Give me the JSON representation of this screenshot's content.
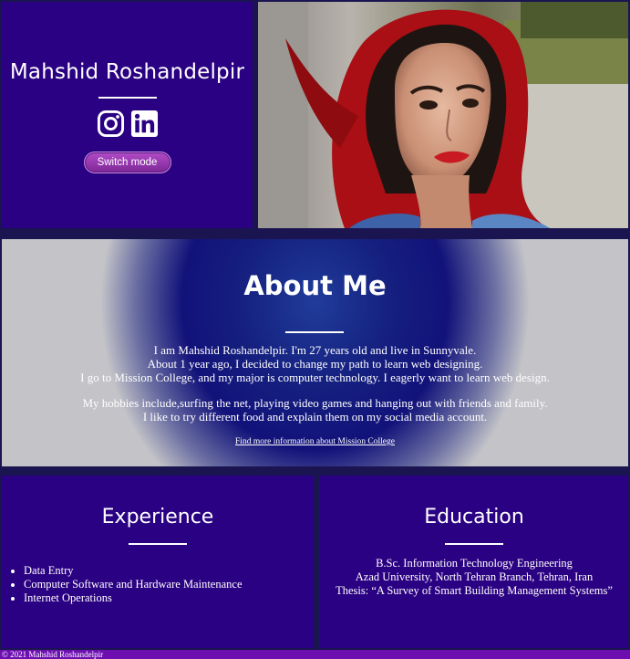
{
  "hero": {
    "name": "Mahshid Roshandelpir",
    "social": [
      {
        "icon": "instagram-icon"
      },
      {
        "icon": "linkedin-icon"
      }
    ],
    "switch_label": "Switch mode",
    "colors": {
      "panel": "#2a0182",
      "button": "#9a3bb6"
    }
  },
  "about": {
    "title": "About Me",
    "paragraph1": [
      "I am Mahshid Roshandelpir. I'm 27 years old and live in Sunnyvale.",
      "About 1 year ago, I decided to change my path to learn web designing.",
      "I go to Mission College, and my major is computer technology. I eagerly want to learn web design."
    ],
    "paragraph2": [
      "My hobbies include,surfing the net, playing video games and hanging out with friends and family.",
      "I like to try different food and explain them on my social media account."
    ],
    "link_text": "Find more information about Mission College"
  },
  "experience": {
    "title": "Experience",
    "items": [
      "Data Entry",
      "Computer Software and Hardware Maintenance",
      "Internet Operations"
    ]
  },
  "education": {
    "title": "Education",
    "lines": [
      "B.Sc. Information Technology Engineering",
      "Azad University, North Tehran Branch, Tehran, Iran",
      "Thesis: “A Survey of Smart Building Management Systems”"
    ]
  },
  "footer": {
    "text": "© 2021 Mahshid Roshandelpir"
  }
}
